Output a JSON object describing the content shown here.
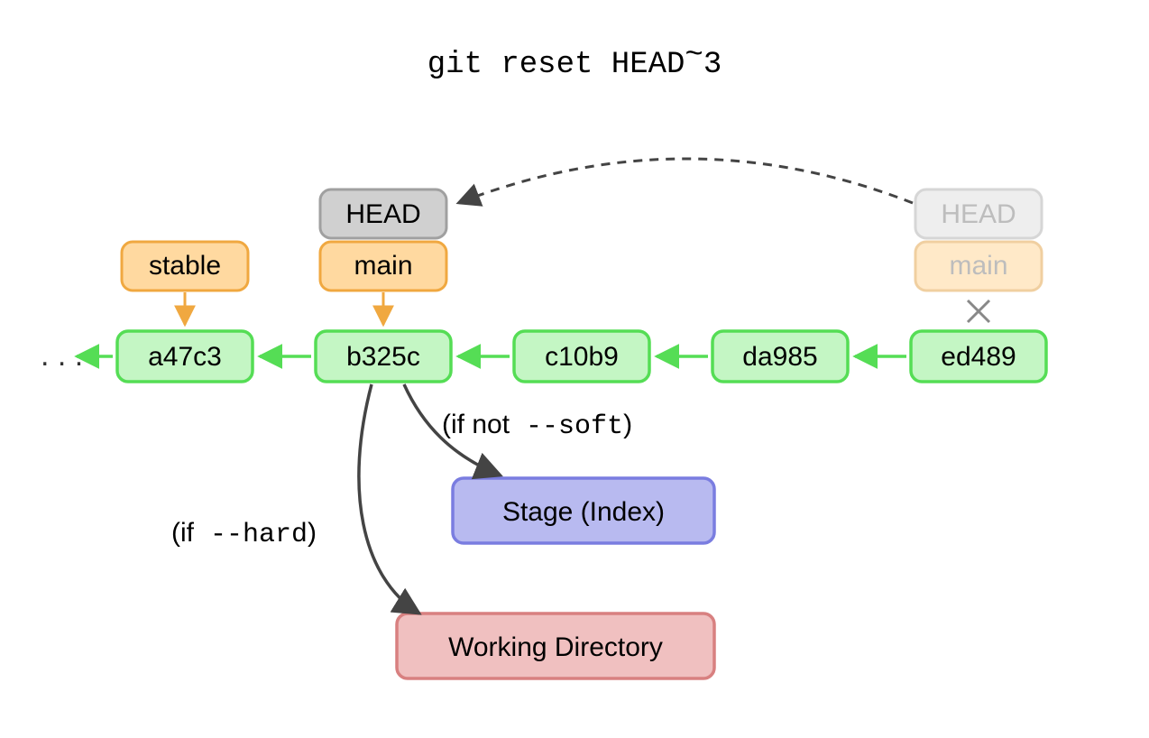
{
  "title_parts": {
    "prefix": "git reset HEAD",
    "tilde": "~",
    "suffix": "3"
  },
  "refs": {
    "stable": "stable",
    "main": "main",
    "head": "HEAD",
    "main_old": "main",
    "head_old": "HEAD"
  },
  "commits": {
    "ellipsis": ". . .",
    "a": "a47c3",
    "b": "b325c",
    "c": "c10b9",
    "d": "da985",
    "e": "ed489"
  },
  "areas": {
    "stage": "Stage (Index)",
    "wd": "Working Directory"
  },
  "labels": {
    "soft_prefix": "(if not",
    "soft_mono": " --soft",
    "close": ")",
    "hard_prefix": "(if",
    "hard_mono": " --hard"
  },
  "colors": {
    "commit_fill": "#c4f6c4",
    "commit_stroke": "#55dd55",
    "ref_fill": "#ffd9a0",
    "ref_stroke": "#f0a840",
    "head_fill": "#d0d0d0",
    "head_stroke": "#a0a0a0",
    "stage_fill": "#b8baf0",
    "stage_stroke": "#7a7de0",
    "wd_fill": "#f0c0c0",
    "wd_stroke": "#d88080",
    "dark_arrow": "#444444",
    "faded_text": "#bdbdbd",
    "faded_orange_fill": "#ffe9c8",
    "faded_orange_stroke": "#f0cfa0",
    "faded_grey_fill": "#eeeeee",
    "faded_grey_stroke": "#d6d6d6"
  }
}
